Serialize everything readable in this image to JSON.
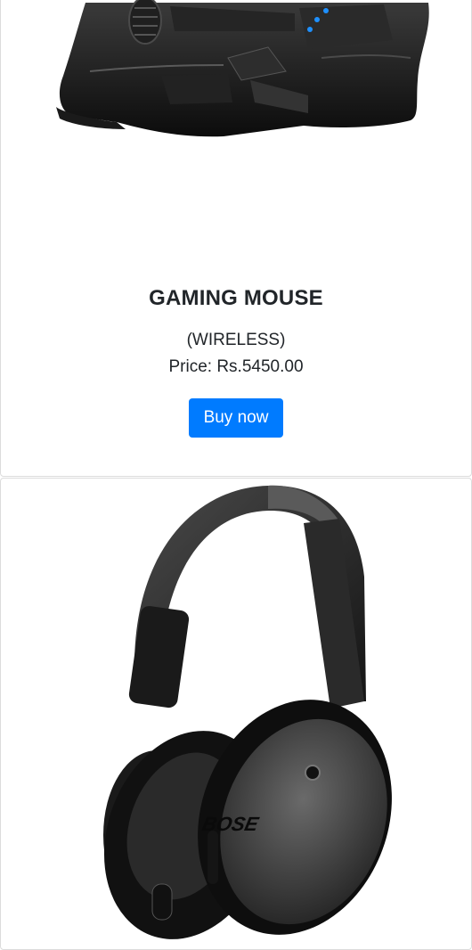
{
  "products": [
    {
      "image_name": "gaming-mouse",
      "title": "GAMING MOUSE",
      "subtitle": "(WIRELESS)",
      "price": "Price: Rs.5450.00",
      "button_label": "Buy now"
    },
    {
      "image_name": "headphones",
      "brand_logo": "BOSE"
    }
  ],
  "colors": {
    "button": "#007bff",
    "title_text": "#212529",
    "card_border": "#dcdcdc",
    "mouse_led": "#1e90ff"
  }
}
